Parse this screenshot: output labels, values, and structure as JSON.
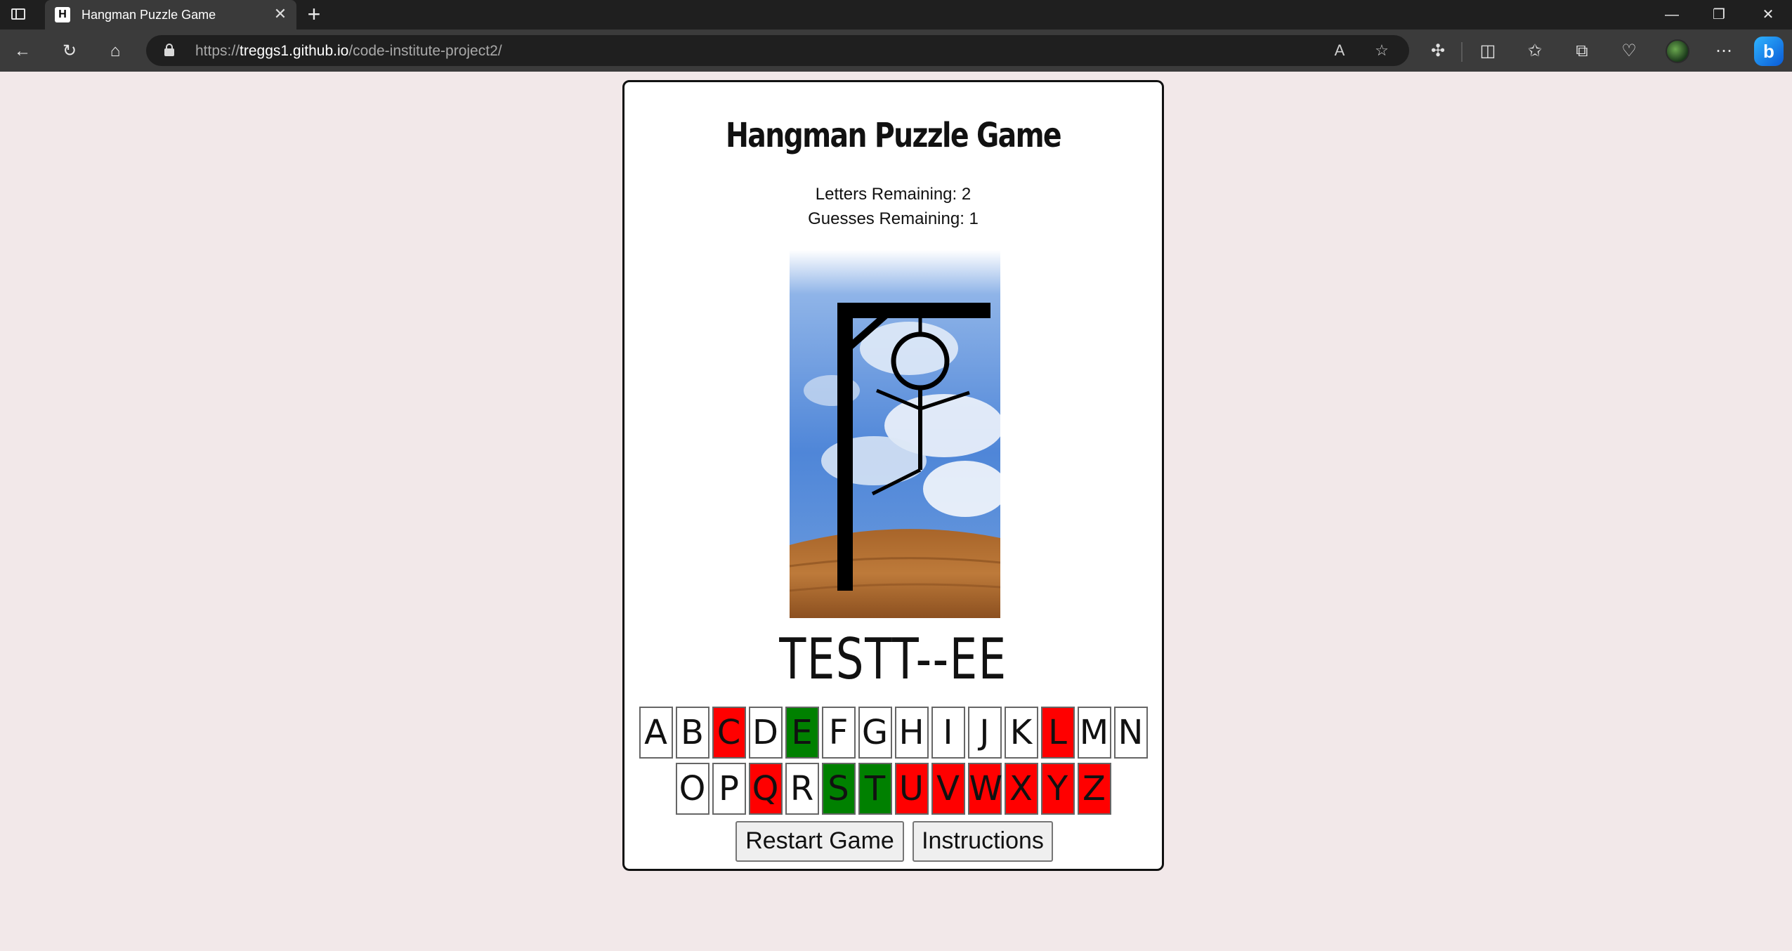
{
  "browser": {
    "tab_title": "Hangman Puzzle Game",
    "tab_favicon": "H",
    "tab_close": "✕",
    "new_tab": "+",
    "url_scheme": "https://",
    "url_host": "treggs1.github.io",
    "url_path": "/code-institute-project2/",
    "window_minimize": "—",
    "window_restore": "❐",
    "window_close": "✕",
    "icons": [
      "tab-actions-icon",
      "back-icon",
      "refresh-icon",
      "home-icon",
      "lock-icon",
      "read-aloud-icon",
      "favorite-star-icon",
      "extensions-icon",
      "split-screen-icon",
      "favorites-icon",
      "collections-icon",
      "browser-essentials-icon",
      "profile-avatar",
      "more-icon",
      "copilot-icon"
    ]
  },
  "game": {
    "title": "Hangman Puzzle Game",
    "letters_remaining": "Letters Remaining: 2",
    "guesses_remaining": "Guesses Remaining: 1",
    "word_display": "TESTT--EE",
    "alphabet_row1": [
      "A",
      "B",
      "C",
      "D",
      "E",
      "F",
      "G",
      "H",
      "I",
      "J",
      "K",
      "L",
      "M",
      "N"
    ],
    "alphabet_row2": [
      "O",
      "P",
      "Q",
      "R",
      "S",
      "T",
      "U",
      "V",
      "W",
      "X",
      "Y",
      "Z"
    ],
    "correct_letters": [
      "E",
      "S",
      "T"
    ],
    "wrong_letters": [
      "C",
      "L",
      "Q",
      "U",
      "V",
      "W",
      "X",
      "Y",
      "Z"
    ],
    "restart_label": "Restart Game",
    "instructions_label": "Instructions"
  },
  "colors": {
    "page_bg": "#f2e8e9",
    "correct": "#008000",
    "wrong": "#ff0000",
    "tab_bar": "#1f1f1f",
    "toolbar": "#3b3b3b"
  }
}
